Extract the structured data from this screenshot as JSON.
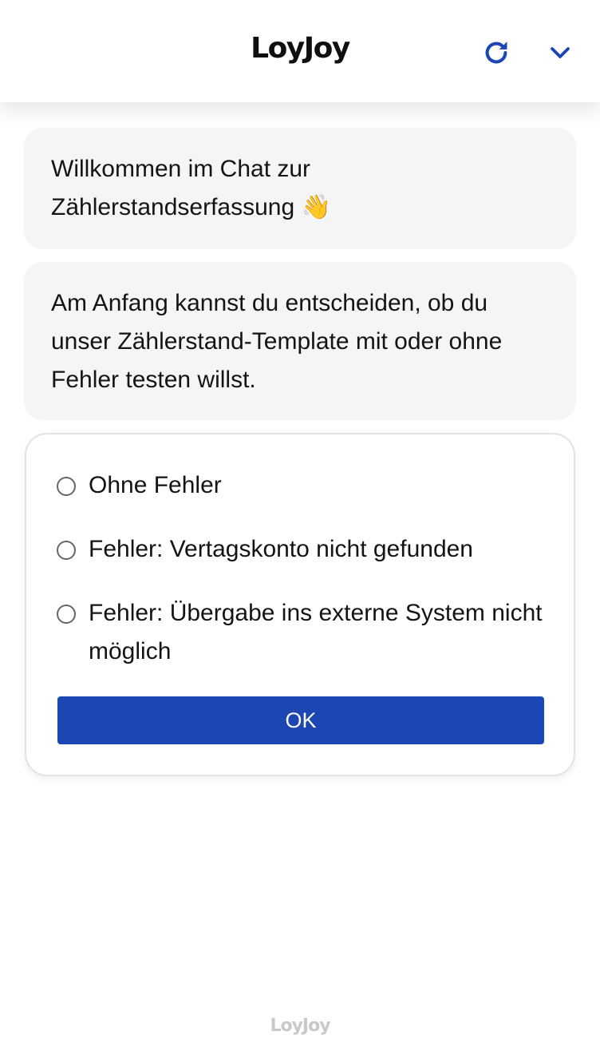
{
  "header": {
    "brand": "LoyJoy",
    "icons": {
      "refresh": "refresh-icon",
      "collapse": "chevron-down-icon"
    },
    "accent_color": "#1b46b4"
  },
  "messages": [
    {
      "text": "Willkommen im Chat zur Zählerstandserfassung 👋"
    },
    {
      "text": "Am Anfang kannst du entscheiden, ob du unser Zählerstand-Template mit oder ohne Fehler testen willst."
    }
  ],
  "choice_card": {
    "options": [
      {
        "label": "Ohne Fehler",
        "selected": false
      },
      {
        "label": "Fehler: Vertagskonto nicht gefunden",
        "selected": false
      },
      {
        "label": "Fehler: Übergabe ins externe System nicht möglich",
        "selected": false
      }
    ],
    "submit_label": "OK"
  },
  "footer": {
    "brand": "LoyJoy"
  }
}
